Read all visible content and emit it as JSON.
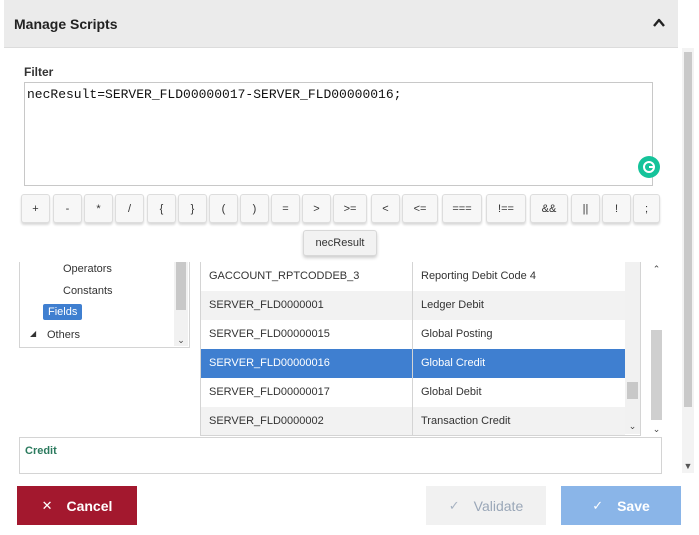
{
  "panel": {
    "title": "Manage Scripts"
  },
  "filter": {
    "label": "Filter",
    "value": "necResult=SERVER_FLD00000017-SERVER_FLD00000016;"
  },
  "operators": [
    "+",
    "-",
    "*",
    "/",
    "{",
    "}",
    "(",
    ")",
    "=",
    ">",
    ">=",
    "<",
    "<=",
    "===",
    "!==",
    "&&",
    "||",
    "!",
    ";"
  ],
  "tooltip": "necResult",
  "tree": {
    "items": [
      {
        "label": "Operators",
        "selected": false
      },
      {
        "label": "Constants",
        "selected": false
      },
      {
        "label": "Fields",
        "selected": true
      },
      {
        "label": "Others",
        "selected": false,
        "expander": "◢"
      }
    ]
  },
  "fields_grid": {
    "rows": [
      {
        "name": "GACCOUNT_RPTCODDEB_3",
        "description": "Reporting Debit Code 4"
      },
      {
        "name": "SERVER_FLD0000001",
        "description": "Ledger Debit"
      },
      {
        "name": "SERVER_FLD00000015",
        "description": "Global Posting"
      },
      {
        "name": "SERVER_FLD00000016",
        "description": "Global Credit",
        "selected": true
      },
      {
        "name": "SERVER_FLD00000017",
        "description": "Global Debit"
      },
      {
        "name": "SERVER_FLD0000002",
        "description": "Transaction Credit"
      }
    ]
  },
  "description_box": {
    "title": "Credit"
  },
  "buttons": {
    "cancel": "Cancel",
    "validate": "Validate",
    "save": "Save"
  },
  "icons": {
    "collapse": "chevron-up-icon",
    "cancel": "close-icon",
    "validate": "check-icon",
    "save": "check-icon",
    "grammarly": "grammarly-icon"
  },
  "colors": {
    "cancel": "#a3182e",
    "save": "#8ab5e8",
    "selected": "#3f7fd0",
    "description_title": "#2b7a5e"
  }
}
